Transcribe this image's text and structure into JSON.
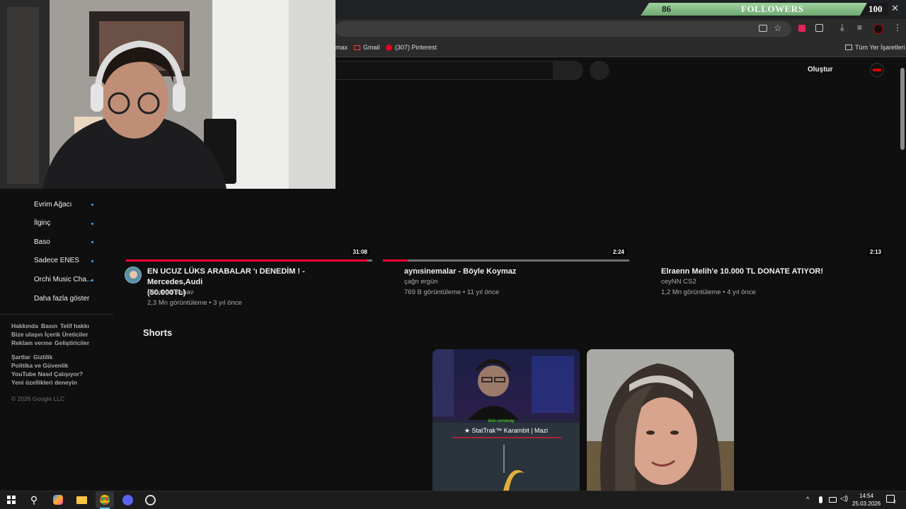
{
  "followers": {
    "current": "86",
    "label": "FOLLOWERS",
    "goal": "100",
    "progress_fraction": 0.86
  },
  "bookmarks": {
    "items": [
      {
        "label": "max"
      },
      {
        "label": "Gmail"
      },
      {
        "label": "(307) Pinterest"
      }
    ],
    "all_label": "Tüm Yer İşaretleri"
  },
  "yt_header": {
    "create_label": "Oluştur"
  },
  "sidebar": {
    "subscriptions": [
      {
        "label": "Evrim Ağacı"
      },
      {
        "label": "İlginç"
      },
      {
        "label": "Baso"
      },
      {
        "label": "Sadece ENES"
      },
      {
        "label": "Orchi Music Cha..."
      }
    ],
    "show_more": "Daha fazla göster",
    "footer_links_1": [
      "Hakkında",
      "Basın",
      "Telif hakkı",
      "Bize ulaşın",
      "İçerik Üreticiler",
      "Reklam verme",
      "Geliştiriciler"
    ],
    "footer_links_2": [
      "Şartlar",
      "Gizlilik",
      "Politika ve Güvenlik",
      "YouTube Nasıl Çalışıyor?",
      "Yeni özellikleri deneyin"
    ],
    "copyright": "© 2026 Google LLC"
  },
  "videos": [
    {
      "title_line1": "EN UCUZ LÜKS ARABALAR 'ı DENEDİM ! - Mercedes,Audi",
      "title_line2": "(50.000TL)",
      "channel": "Mevtcan Bahav",
      "meta": "2,3 Mn görüntüleme • 3 yıl önce",
      "duration": "31:08",
      "watched": 0.98
    },
    {
      "title_line1": "aynısinemalar - Böyle Koymaz",
      "title_line2": "",
      "channel": "çağn ergün",
      "meta": "769 B görüntüleme • 11 yıl önce",
      "duration": "2:24",
      "watched": 0.1
    },
    {
      "title_line1": "Elraenn Melih'e 10.000 TL DONATE ATIYOR!",
      "title_line2": "",
      "channel": "ceyNN CS2",
      "meta": "1,2 Mn görüntüleme • 4 yıl önce",
      "duration": "2:13",
      "watched": 0
    }
  ],
  "shorts": {
    "heading": "Shorts",
    "items": [
      {
        "overlay_url": "kick.com/eray",
        "overlay_text": "★ StatTrak™ Karambit | Mazi"
      },
      {}
    ]
  },
  "taskbar": {
    "time": "14:54",
    "date": "25.03.2026",
    "notifications": "2"
  },
  "colors": {
    "background": "#0f0f0f",
    "accent_red": "#ff0033",
    "followers_green": "#8cc58d",
    "link_blue": "#3ea6ff"
  }
}
